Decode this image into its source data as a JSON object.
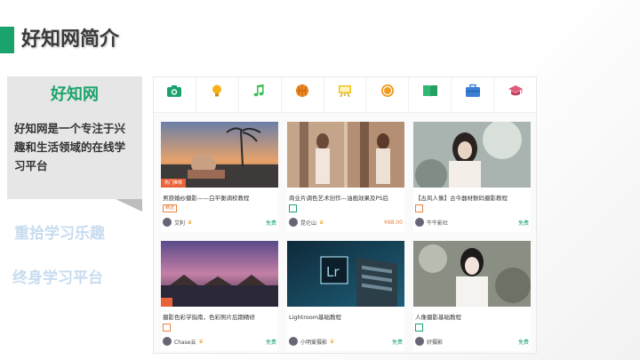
{
  "slide": {
    "title": "好知网简介",
    "brand": "好知网",
    "description": "好知网是一个专注于兴趣和生活领域的在线学习平台",
    "slogan_1": "重拾学习乐趣",
    "slogan_2": "终身学习平台",
    "accent_color": "#1aa46b"
  },
  "categories": [
    {
      "icon": "camera-icon",
      "color": "#1aa46b"
    },
    {
      "icon": "lightbulb-icon",
      "color": "#f3b21b"
    },
    {
      "icon": "music-note-icon",
      "color": "#3fbf5a"
    },
    {
      "icon": "basketball-icon",
      "color": "#f08a24"
    },
    {
      "icon": "easel-icon",
      "color": "#f3c21b"
    },
    {
      "icon": "coin-icon",
      "color": "#f29c1f"
    },
    {
      "icon": "book-icon",
      "color": "#2eb872"
    },
    {
      "icon": "briefcase-icon",
      "color": "#3a7fd5"
    },
    {
      "icon": "graduation-cap-icon",
      "color": "#e05a7a"
    }
  ],
  "courses": [
    {
      "title": "男旅婚纱摄影——白平衡调校教程",
      "tag": "精选",
      "price": "免费"
    },
    {
      "title": "商业片调色艺术创作—油画效果及PS后",
      "tag": "",
      "price": "¥88.00"
    },
    {
      "title": "【古风人像】古今器材数码摄影教程",
      "tag": "",
      "price": "免费"
    },
    {
      "title": "摄影色彩学指南，色彩照片后期精修",
      "tag": "",
      "price": "免费"
    },
    {
      "title": "Lightroom基础教程",
      "tag": "",
      "price": "免费"
    },
    {
      "title": "人像摄影基础教程",
      "tag": "",
      "price": "免费"
    }
  ],
  "authors": [
    {
      "name": "艾利"
    },
    {
      "name": "昆仑山"
    },
    {
      "name": "牛牛影社"
    },
    {
      "name": "Chase云"
    },
    {
      "name": "小明爱摄影"
    },
    {
      "name": "好摄影"
    }
  ],
  "badges": {
    "featured": "热门推荐"
  }
}
